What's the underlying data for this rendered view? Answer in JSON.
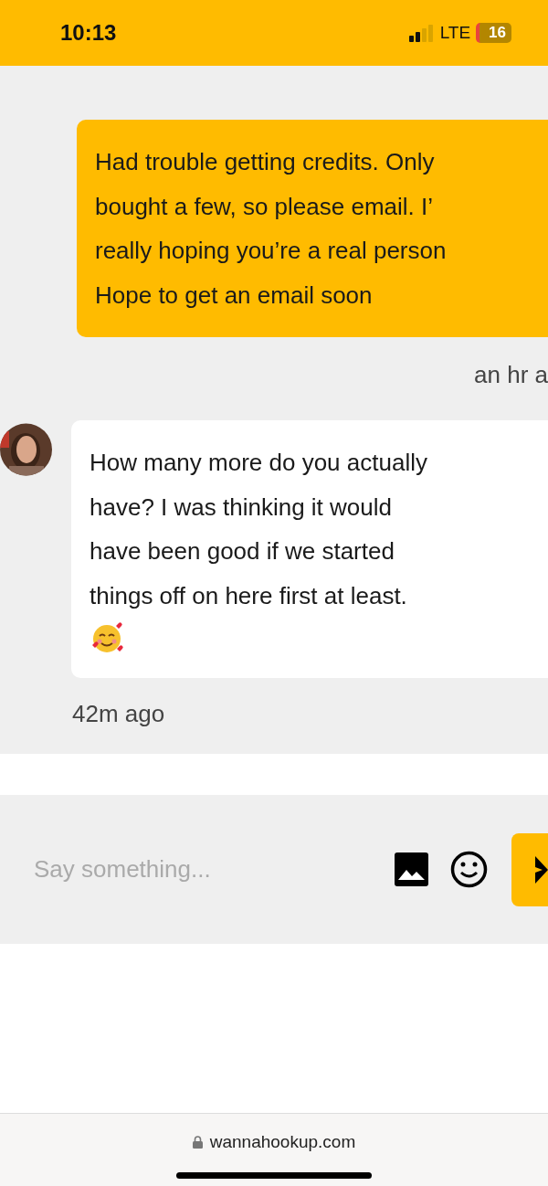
{
  "status_bar": {
    "time": "10:13",
    "network": "LTE",
    "battery": "16"
  },
  "messages": [
    {
      "kind": "outgoing",
      "lines": [
        "Had trouble getting credits. Only",
        "bought a few, so please email. I’",
        "really hoping you’re a real person",
        "Hope to get an email soon"
      ],
      "time": "an hr a"
    },
    {
      "kind": "incoming",
      "text": "How many more do you actually have? I was thinking it would have been good if we started things off on here first at least.",
      "emoji": true,
      "time": "42m ago"
    }
  ],
  "composer": {
    "placeholder": "Say something..."
  },
  "browser_bar": {
    "url": "wannahookup.com"
  }
}
